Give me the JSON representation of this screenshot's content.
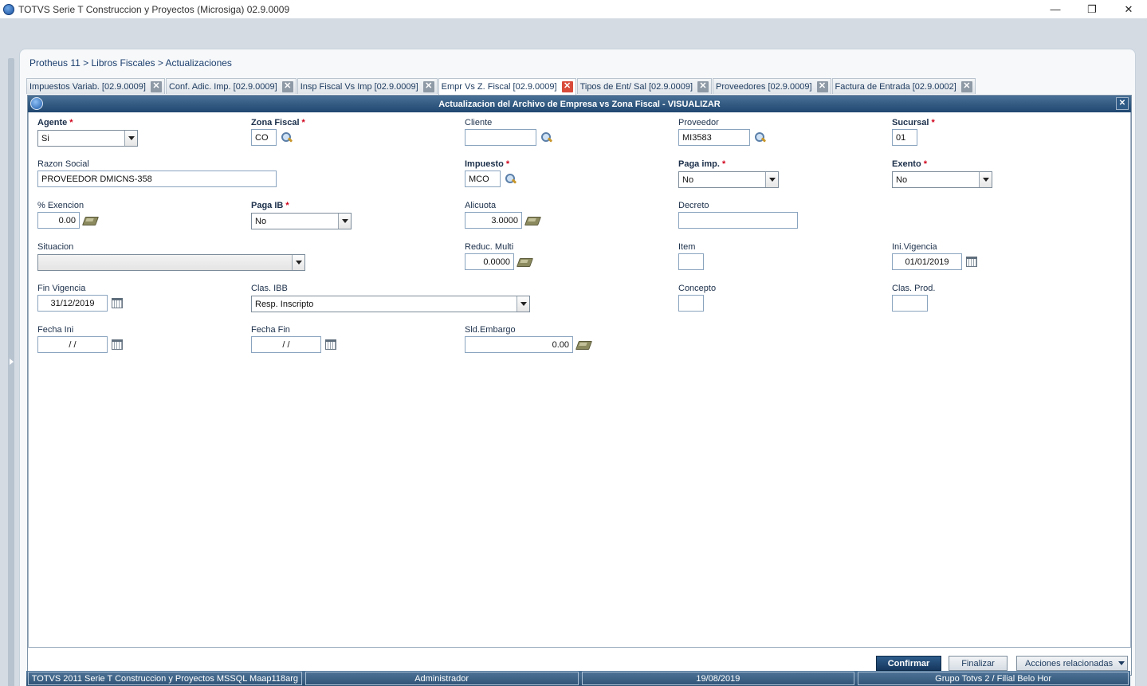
{
  "window": {
    "title": "TOTVS Serie T Construccion y Proyectos (Microsiga) 02.9.0009",
    "minimize": "—",
    "restore": "❐",
    "close": "✕"
  },
  "breadcrumb": "Protheus 11 > Libros Fiscales > Actualizaciones",
  "tabs": [
    {
      "label": "Impuestos Variab. [02.9.0009]"
    },
    {
      "label": "Conf. Adic. Imp. [02.9.0009]"
    },
    {
      "label": "Insp Fiscal Vs Imp [02.9.0009]"
    },
    {
      "label": "Empr Vs Z. Fiscal [02.9.0009]"
    },
    {
      "label": "Tipos de Ent/ Sal [02.9.0009]"
    },
    {
      "label": "Proveedores [02.9.0009]"
    },
    {
      "label": "Factura de Entrada [02.9.0002]"
    }
  ],
  "tab_close": "✕",
  "dialog": {
    "title": "Actualizacion del Archivo de Empresa vs Zona Fiscal - VISUALIZAR",
    "close": "✕"
  },
  "required_mark": "*",
  "fields": {
    "agente": {
      "label": "Agente",
      "value": "Si"
    },
    "zona_fiscal": {
      "label": "Zona Fiscal",
      "value": "CO"
    },
    "cliente": {
      "label": "Cliente",
      "value": ""
    },
    "proveedor": {
      "label": "Proveedor",
      "value": "MI3583"
    },
    "sucursal": {
      "label": "Sucursal",
      "value": "01"
    },
    "razon_social": {
      "label": "Razon Social",
      "value": "PROVEEDOR DMICNS-358"
    },
    "impuesto": {
      "label": "Impuesto",
      "value": "MCO"
    },
    "paga_imp": {
      "label": "Paga imp.",
      "value": "No"
    },
    "exento": {
      "label": "Exento",
      "value": "No"
    },
    "pct_exencion": {
      "label": "% Exencion",
      "value": "0.00"
    },
    "paga_ib": {
      "label": "Paga IB",
      "value": "No"
    },
    "alicuota": {
      "label": "Alicuota",
      "value": "3.0000"
    },
    "decreto": {
      "label": "Decreto",
      "value": ""
    },
    "situacion": {
      "label": "Situacion",
      "value": ""
    },
    "reduc_multi": {
      "label": "Reduc. Multi",
      "value": "0.0000"
    },
    "item": {
      "label": "Item",
      "value": ""
    },
    "ini_vigencia": {
      "label": "Ini.Vigencia",
      "value": "01/01/2019"
    },
    "fin_vigencia": {
      "label": "Fin Vigencia",
      "value": "31/12/2019"
    },
    "clas_ibb": {
      "label": "Clas. IBB",
      "value": "Resp. Inscripto"
    },
    "concepto": {
      "label": "Concepto",
      "value": ""
    },
    "clas_prod": {
      "label": "Clas. Prod.",
      "value": ""
    },
    "fecha_ini": {
      "label": "Fecha Ini",
      "value": "/ /"
    },
    "fecha_fin": {
      "label": "Fecha Fin",
      "value": "/ /"
    },
    "sld_embargo": {
      "label": "Sld.Embargo",
      "value": "0.00"
    }
  },
  "buttons": {
    "confirmar": "Confirmar",
    "finalizar": "Finalizar",
    "acciones": "Acciones relacionadas"
  },
  "status": {
    "system": "TOTVS 2011 Serie T Construccion y Proyectos MSSQL Maap118arg",
    "user": "Administrador",
    "date": "19/08/2019",
    "company": "Grupo Totvs 2 / Filial Belo Hor"
  }
}
